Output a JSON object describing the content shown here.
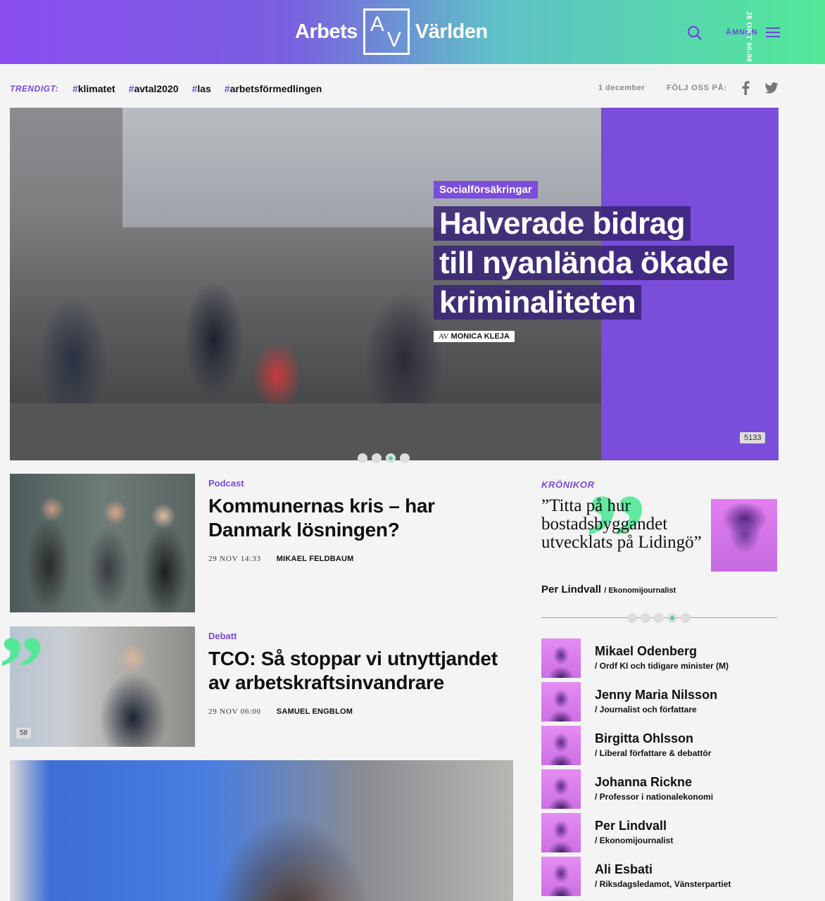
{
  "header": {
    "logo_left": "Arbets",
    "logo_a": "A",
    "logo_v": "V",
    "logo_right": "Världen",
    "search_icon": "search-icon",
    "topics_label": "ÄMNEN",
    "menu_icon": "hamburger-icon"
  },
  "trending": {
    "label": "TRENDIGT:",
    "tags": [
      "klimatet",
      "avtal2020",
      "las",
      "arbetsförmedlingen"
    ],
    "date": "1 december",
    "follow_label": "FÖLJ OSS PÅ:",
    "social_icons": [
      "facebook-icon",
      "twitter-icon"
    ]
  },
  "hero": {
    "category": "Socialförsäkringar",
    "title_lines": [
      "Halverade bidrag",
      "till nyanlända ökade",
      "kriminaliteten"
    ],
    "byline_prefix": "AV",
    "author": "MONICA KLEJA",
    "date": "28 OKT 06:00",
    "count": "5133",
    "slides": 4,
    "active_slide": 3
  },
  "articles": [
    {
      "category": "Podcast",
      "title": "Kommunernas kris – har Danmark lösningen?",
      "date": "29 NOV 14:33",
      "author": "MIKAEL FELDBAUM"
    },
    {
      "category": "Debatt",
      "title": "TCO: Så stoppar vi utnyttjandet av arbetskraftsinvandrare",
      "date": "29 NOV 06:00",
      "author": "SAMUEL ENGBLOM",
      "quote_mark": "”",
      "count": "58"
    }
  ],
  "kronikor": {
    "label": "KRÖNIKOR",
    "quote": "”Titta på hur bostadsbyggandet utvecklats på Lidingö”",
    "author": "Per Lindvall",
    "role": "/ Ekonomijournalist",
    "slides": 5,
    "active_slide": 4
  },
  "columnists": [
    {
      "name": "Mikael Odenberg",
      "role": "/ Ordf KI och tidigare minister (M)"
    },
    {
      "name": "Jenny Maria Nilsson",
      "role": "/ Journalist och författare"
    },
    {
      "name": "Birgitta Ohlsson",
      "role": "/ Liberal författare & debattör"
    },
    {
      "name": "Johanna Rickne",
      "role": "/ Professor i nationalekonomi"
    },
    {
      "name": "Per Lindvall",
      "role": "/ Ekonomijournalist"
    },
    {
      "name": "Ali Esbati",
      "role": "/ Riksdagsledamot, Vänsterpartiet"
    }
  ],
  "colors": {
    "accent_purple": "#7a4ddb",
    "accent_green": "#52e898"
  }
}
